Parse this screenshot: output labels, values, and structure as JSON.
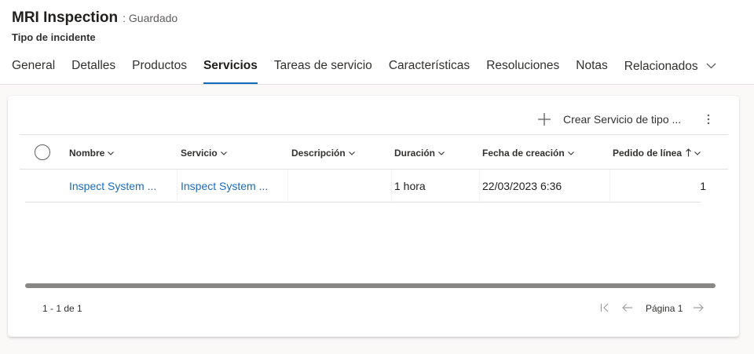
{
  "header": {
    "title": "MRI Inspection",
    "status": ": Guardado",
    "subtitle": "Tipo de incidente"
  },
  "tabs": [
    {
      "label": "General",
      "active": false
    },
    {
      "label": "Detalles",
      "active": false
    },
    {
      "label": "Productos",
      "active": false
    },
    {
      "label": "Servicios",
      "active": true
    },
    {
      "label": "Tareas de servicio",
      "active": false
    },
    {
      "label": "Características",
      "active": false
    },
    {
      "label": "Resoluciones",
      "active": false
    },
    {
      "label": "Notas",
      "active": false
    },
    {
      "label": "Relacionados",
      "active": false,
      "has_dropdown": true
    }
  ],
  "command_bar": {
    "create_label": "Crear Servicio de tipo ...",
    "create_icon": "plus-icon",
    "more_icon": "more-vertical-icon"
  },
  "grid": {
    "columns": [
      {
        "label": "Nombre",
        "sort": "none"
      },
      {
        "label": "Servicio",
        "sort": "none"
      },
      {
        "label": "Descripción",
        "sort": "none"
      },
      {
        "label": "Duración",
        "sort": "none"
      },
      {
        "label": "Fecha de creación",
        "sort": "none"
      },
      {
        "label": "Pedido de línea",
        "sort": "ascending"
      }
    ],
    "rows": [
      {
        "nombre": "Inspect System ...",
        "servicio": "Inspect System ...",
        "descripcion": "",
        "duracion": "1 hora",
        "fecha": "22/03/2023 6:36",
        "pedido": "1"
      }
    ]
  },
  "pager": {
    "info": "1 - 1 de 1",
    "page_label": "Página 1"
  },
  "colors": {
    "accent": "#0f6cbd",
    "link": "#1a6bbf",
    "text": "#201f1e",
    "divider": "#e1dfdd"
  }
}
